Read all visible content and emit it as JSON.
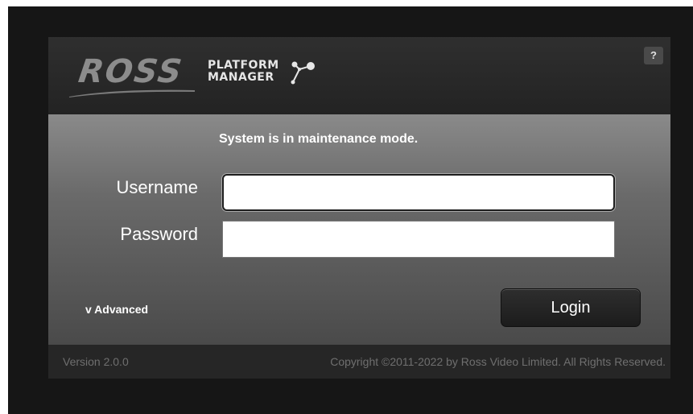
{
  "header": {
    "logo_text": "ROSS",
    "product_line1": "PLATFORM",
    "product_line2": "MANAGER",
    "help_label": "?"
  },
  "form": {
    "status_message": "System is in maintenance mode.",
    "username_label": "Username",
    "username_value": "",
    "password_label": "Password",
    "password_value": "",
    "advanced_label": "v Advanced",
    "login_label": "Login"
  },
  "footer": {
    "version": "Version 2.0.0",
    "copyright": "Copyright ©2011-2022 by Ross Video Limited. All Rights Reserved."
  },
  "colors": {
    "frame_background": "#161616",
    "panel_header": "#2b2b2b",
    "button_background": "#232323",
    "footer_text": "#6f6f6f"
  }
}
